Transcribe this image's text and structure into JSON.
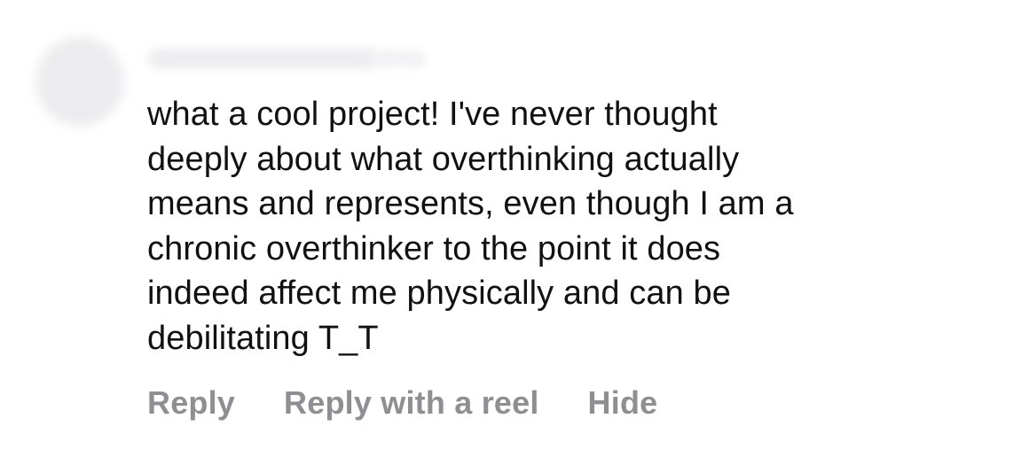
{
  "comment": {
    "text_lines": [
      "what a cool project! I've never thought",
      "deeply about what overthinking actually",
      "means and represents, even though I am a",
      "chronic overthinker to the point it does",
      "indeed affect me physically and can be",
      "debilitating T_T"
    ]
  },
  "actions": {
    "reply_label": "Reply",
    "reply_with_reel_label": "Reply with a reel",
    "hide_label": "Hide"
  }
}
